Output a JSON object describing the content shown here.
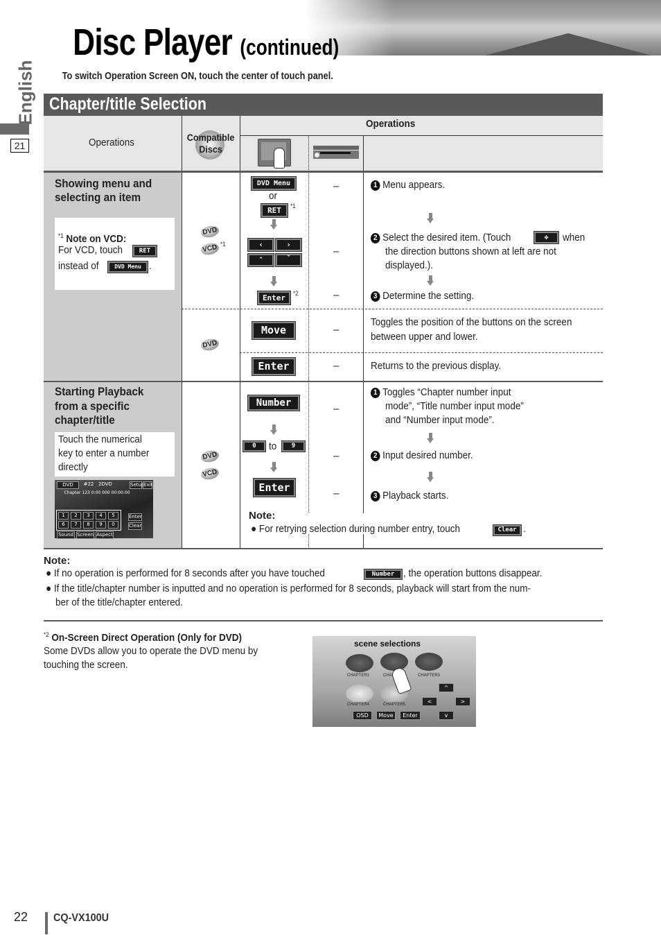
{
  "page": {
    "title": "Disc Player",
    "title_suffix": "(continued)",
    "intro": "To switch Operation Screen ON, touch the center of touch panel.",
    "side_label": "English",
    "side_page": "21",
    "page_number": "22",
    "model": "CQ-VX100U"
  },
  "section": {
    "title": "Chapter/title Selection",
    "header": {
      "operations_col": "Operations",
      "compatible_line1": "Compatible",
      "compatible_line2": "Discs",
      "operations_group": "Operations",
      "icons": [
        "touch-panel-icon",
        "head-unit-icon"
      ]
    },
    "rows": [
      {
        "name": "Showing menu and selecting an item",
        "line1": "Showing menu and",
        "line2": "selecting an item",
        "note": {
          "marker": "*1",
          "title": "Note on VCD:",
          "line1": "For VCD, touch",
          "line1_button": "RET",
          "line2": "instead of",
          "line2_button": "DVD Menu",
          "line2_end": "."
        },
        "discs": [
          "DVD",
          "VCD"
        ],
        "vcd_marker": "*1",
        "buttons": {
          "dvd_menu": "DVD Menu",
          "or": "or",
          "ret": "RET",
          "ret_marker": "*1",
          "left": "‹",
          "right": "›",
          "up": "ˆ",
          "down": "ˇ",
          "enter": "Enter",
          "enter_marker": "*2"
        },
        "unit_ops": [
          "–",
          "–",
          "–"
        ],
        "steps": [
          {
            "num": "1",
            "text": "Menu appears."
          },
          {
            "num": "2",
            "text1": "Select the desired item. (Touch",
            "icon": "direction-icon",
            "text2": "when",
            "line2": "the direction buttons shown at left are not",
            "line3": "displayed.)."
          },
          {
            "num": "3",
            "text": "Determine the setting."
          }
        ]
      },
      {
        "name": "Move / Enter",
        "discs": [
          "DVD"
        ],
        "subrows": [
          {
            "button": "Move",
            "unit_op": "–",
            "line1": "Toggles the position of the buttons on the screen",
            "line2": "between upper and lower."
          },
          {
            "button": "Enter",
            "unit_op": "–",
            "line1": "Returns to the previous display."
          }
        ]
      },
      {
        "name": "Starting Playback from a specific chapter/title",
        "line1": "Starting Playback",
        "line2": "from a specific",
        "line3": "chapter/title",
        "note_lines": [
          "Touch the numerical",
          "key to enter a number",
          "directly"
        ],
        "discs": [
          "DVD",
          "VCD"
        ],
        "buttons": {
          "number": "Number",
          "zero": "0",
          "to": "to",
          "nine": "9",
          "enter": "Enter"
        },
        "unit_ops": [
          "–",
          "–",
          "–"
        ],
        "steps": [
          {
            "num": "1",
            "lines": [
              "Toggles “Chapter number input",
              "mode”, “Title number input mode”",
              "and “Number input mode”."
            ]
          },
          {
            "num": "2",
            "text": "Input desired number."
          },
          {
            "num": "3",
            "text": "Playback starts."
          }
        ],
        "note_title": "Note:",
        "note_text": "For retrying selection during number entry, touch",
        "note_button": "Clear",
        "note_end": ".",
        "screen": {
          "top": [
            "DVD",
            "#22",
            "2DVD",
            "Setup",
            "Exit"
          ],
          "info": "Chapter 123  0:00  000 00:00:00",
          "keys": [
            "1",
            "2",
            "3",
            "4",
            "5",
            "6",
            "7",
            "8",
            "9",
            "0"
          ],
          "side": [
            "Enter",
            "Clear"
          ],
          "bottom": [
            "Sound",
            "Screen",
            "Aspect"
          ]
        }
      }
    ]
  },
  "notes": {
    "title": "Note:",
    "bullet1_a": "If no operation is performed for 8 seconds after you have touched",
    "bullet1_button": "Number",
    "bullet1_b": ", the operation buttons disappear.",
    "bullet2_line1": "If the title/chapter number is inputted and no operation is performed for 8 seconds, playback will start from the num-",
    "bullet2_line2": "ber of the title/chapter entered."
  },
  "footnote": {
    "marker": "*2",
    "title": "On-Screen Direct Operation (Only for DVD)",
    "line1": "Some DVDs allow you to operate the DVD menu by",
    "line2": "touching the screen.",
    "image": {
      "title": "scene selections",
      "chapters": [
        "CHAPTER1",
        "CHAPTER2",
        "CHAPTER3",
        "CHAPTER4",
        "CHAPTER5"
      ],
      "buttons": [
        "OSD",
        "Move",
        "Enter"
      ],
      "arrows": [
        "^",
        "<",
        ">",
        "v"
      ]
    }
  }
}
